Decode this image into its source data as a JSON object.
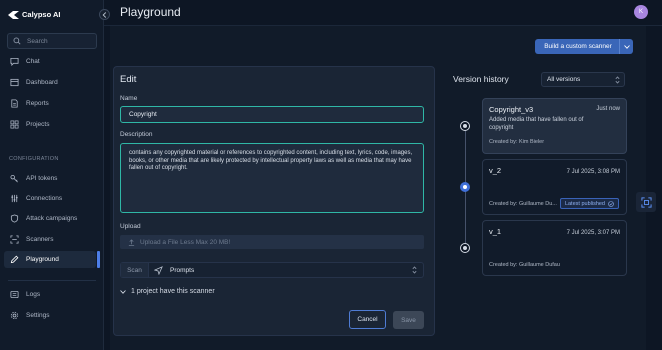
{
  "app": {
    "logo_text": "Calypso AI",
    "avatar_initial": "K"
  },
  "sidebar": {
    "search_placeholder": "Search",
    "items": [
      {
        "label": "Chat"
      },
      {
        "label": "Dashboard"
      },
      {
        "label": "Reports"
      },
      {
        "label": "Projects"
      }
    ],
    "section_label": "CONFIGURATION",
    "config_items": [
      {
        "label": "API tokens"
      },
      {
        "label": "Connections"
      },
      {
        "label": "Attack campaigns"
      },
      {
        "label": "Scanners"
      },
      {
        "label": "Playground"
      }
    ],
    "active_item": "Playground",
    "bottom_items": [
      {
        "label": "Logs"
      },
      {
        "label": "Settings"
      }
    ]
  },
  "header": {
    "title": "Playground"
  },
  "toolbar": {
    "build_label": "Build a custom scanner"
  },
  "edit": {
    "title": "Edit",
    "name_label": "Name",
    "name_value": "Copyright",
    "description_label": "Description",
    "description_value": "contains any copyrighted material or references to copyrighted content, including text, lyrics, code, images, books, or other media that are likely protected by intellectual property laws as well as media that may have fallen out of copyright.",
    "upload_label": "Upload",
    "upload_placeholder": "Upload a File Less Max 20 MB!",
    "scan_tab": "Scan",
    "scan_target": "Prompts",
    "projects_toggle": "1 project have this scanner",
    "cancel_label": "Cancel",
    "save_label": "Save"
  },
  "version_history": {
    "title": "Version history",
    "filter_value": "All versions",
    "versions": [
      {
        "name": "Copyright_v3",
        "time": "Just now",
        "description": "Added media that have fallen out of copyright",
        "created_by": "Created by: Kim Bieler"
      },
      {
        "name": "v_2",
        "time": "7 Jul 2025, 3:08 PM",
        "description": "",
        "created_by": "Created by: Guillaume Du...",
        "badge": "Latest published"
      },
      {
        "name": "v_1",
        "time": "7 Jul 2025, 3:07 PM",
        "description": "",
        "created_by": "Created by: Guillaume Dufau"
      }
    ]
  },
  "colors": {
    "accent": "#3a66b8",
    "focus": "#2fb7a6",
    "background": "#0d1624"
  }
}
